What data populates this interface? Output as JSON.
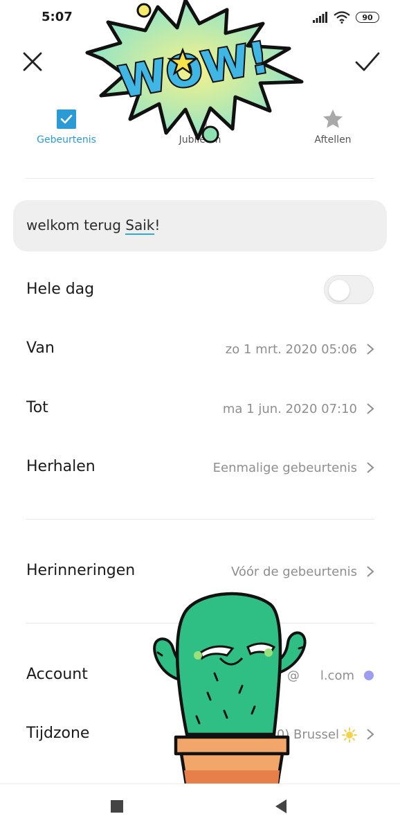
{
  "status_bar": {
    "time": "5:07",
    "battery": "90"
  },
  "tabs": [
    {
      "label": "Gebeurtenis",
      "active": true
    },
    {
      "label": "Jubileum",
      "active": false
    },
    {
      "label": "Aftellen",
      "active": false
    }
  ],
  "title": {
    "before": "welkom terug ",
    "underlined": "Saik",
    "after": "!"
  },
  "rows": {
    "all_day": {
      "label": "Hele dag",
      "on": false
    },
    "from": {
      "label": "Van",
      "value": "zo 1 mrt. 2020 05:06"
    },
    "to": {
      "label": "Tot",
      "value": "ma 1 jun. 2020 07:10"
    },
    "repeat": {
      "label": "Herhalen",
      "value": "Eenmalige gebeurtenis"
    },
    "reminders": {
      "label": "Herinneringen",
      "value": "Vóór de gebeurtenis"
    },
    "account": {
      "label": "Account",
      "value": "@",
      "value_tail": "l.com",
      "dot_color": "#9e9cf0"
    },
    "timezone": {
      "label": "Tijdzone",
      "value": "0) Brussel"
    }
  },
  "stickers": {
    "wow_text": "WOW!"
  },
  "colors": {
    "accent": "#2b9bd6",
    "text": "#1a1a1a",
    "secondary": "#8e8e8e"
  }
}
